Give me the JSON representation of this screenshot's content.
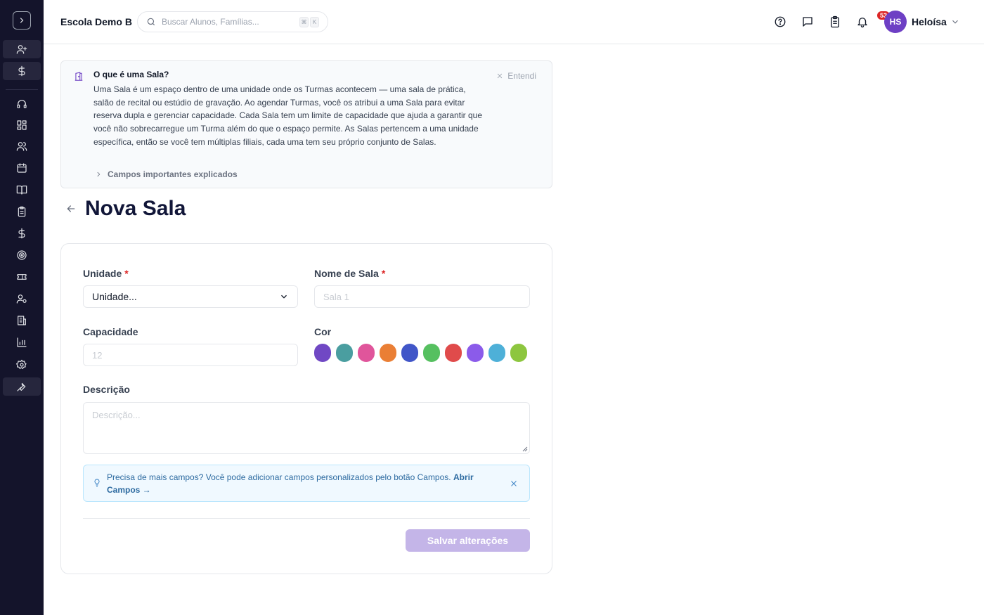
{
  "topbar": {
    "school_name": "Escola Demo B",
    "search_placeholder": "Buscar Alunos, Famílias...",
    "kbd_1": "⌘",
    "kbd_2": "K",
    "notification_count": "53",
    "user_initials": "HS",
    "user_name": "Heloísa"
  },
  "sidebar": {
    "items": [
      {
        "icon": "user-plus-icon"
      },
      {
        "icon": "dollar-icon"
      },
      {
        "icon": "headset-icon"
      },
      {
        "icon": "dashboard-icon"
      },
      {
        "icon": "users-icon"
      },
      {
        "icon": "calendar-icon"
      },
      {
        "icon": "book-icon"
      },
      {
        "icon": "clipboard-icon"
      },
      {
        "icon": "dollar-icon"
      },
      {
        "icon": "target-icon"
      },
      {
        "icon": "ticket-icon"
      },
      {
        "icon": "user-gear-icon"
      },
      {
        "icon": "building-icon"
      },
      {
        "icon": "bar-chart-icon"
      },
      {
        "icon": "gear-icon"
      },
      {
        "icon": "wrench-icon"
      }
    ]
  },
  "info": {
    "title": "O que é uma Sala?",
    "text": "Uma Sala é um espaço dentro de uma unidade onde os Turmas acontecem — uma sala de prática, salão de recital ou estúdio de gravação. Ao agendar Turmas, você os atribui a uma Sala para evitar reserva dupla e gerenciar capacidade. Cada Sala tem um limite de capacidade que ajuda a garantir que você não sobrecarregue um Turma além do que o espaço permite. As Salas pertencem a uma unidade específica, então se você tem múltiplas filiais, cada uma tem seu próprio conjunto de Salas.",
    "dismiss": "Entendi",
    "expand": "Campos importantes explicados"
  },
  "page": {
    "title": "Nova Sala"
  },
  "form": {
    "unit_label": "Unidade",
    "unit_value": "Unidade...",
    "name_label": "Nome de Sala",
    "name_placeholder": "Sala 1",
    "capacity_label": "Capacidade",
    "capacity_placeholder": "12",
    "color_label": "Cor",
    "colors": [
      "#7048c4",
      "#4a9ea0",
      "#e0559b",
      "#ea7f35",
      "#4156c8",
      "#56c060",
      "#e04b4b",
      "#8b5bea",
      "#4eb0d8",
      "#8dc63f"
    ],
    "description_label": "Descrição",
    "description_placeholder": "Descrição...",
    "required_mark": "*",
    "tip_text": "Precisa de mais campos? Você pode adicionar campos personalizados pelo botão Campos.",
    "tip_link": "Abrir Campos →",
    "save_label": "Salvar alterações"
  }
}
